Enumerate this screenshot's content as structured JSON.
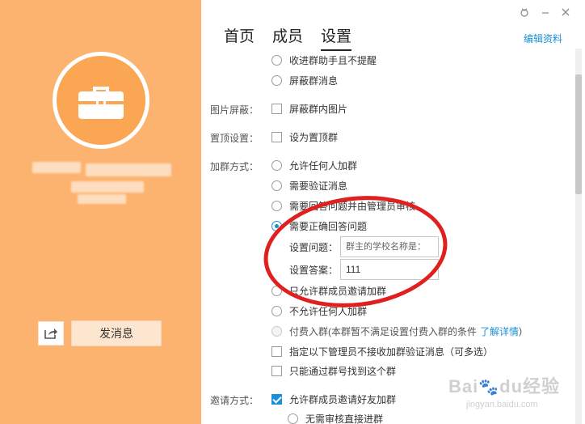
{
  "window": {
    "skin_icon": "skin-icon",
    "minimize_icon": "minimize-icon",
    "close_icon": "close-icon"
  },
  "profile": {
    "avatar_icon": "briefcase-icon",
    "share_icon": "share-icon",
    "send_message_label": "发消息"
  },
  "tabs": [
    {
      "label": "首页",
      "active": false
    },
    {
      "label": "成员",
      "active": false
    },
    {
      "label": "设置",
      "active": true
    }
  ],
  "edit_profile_label": "编辑资料",
  "settings": {
    "message_options": [
      {
        "label": "收进群助手且不提醒",
        "checked": false
      },
      {
        "label": "屏蔽群消息",
        "checked": false
      }
    ],
    "image_block": {
      "label": "图片屏蔽：",
      "option": {
        "label": "屏蔽群内图片",
        "checked": false
      }
    },
    "pin_top": {
      "label": "置顶设置：",
      "option": {
        "label": "设为置顶群",
        "checked": false
      }
    },
    "join_method": {
      "label": "加群方式：",
      "options": [
        {
          "label": "允许任何人加群",
          "checked": false
        },
        {
          "label": "需要验证消息",
          "checked": false
        },
        {
          "label": "需要回答问题并由管理员审核",
          "checked": false
        },
        {
          "label": "需要正确回答问题",
          "checked": true
        }
      ],
      "question": {
        "label": "设置问题：",
        "placeholder": "群主的学校名称是："
      },
      "answer": {
        "label": "设置答案：",
        "value": "111"
      },
      "more_options": [
        {
          "label": "只允许群成员邀请加群",
          "checked": false
        },
        {
          "label": "不允许任何人加群",
          "checked": false
        }
      ],
      "paid_join": {
        "label": "付费入群(本群暂不满足设置付费入群的条件",
        "link": "了解详情",
        "suffix": ")",
        "disabled": true
      },
      "admin_exclude": {
        "label": "指定以下管理员不接收加群验证消息（可多选）",
        "checked": false
      },
      "find_by_number": {
        "label": "只能通过群号找到这个群",
        "checked": false
      }
    },
    "invite_method": {
      "label": "邀请方式：",
      "option": {
        "label": "允许群成员邀请好友加群",
        "checked": true
      },
      "sub_option": {
        "label": "无需审核直接进群",
        "checked": false
      }
    }
  },
  "watermark": {
    "main": "Bai\u0000du经验",
    "sub": "jingyan.baidu.com"
  },
  "colors": {
    "sidebar": "#fcb36f",
    "accent": "#1a90d6",
    "annotation": "#e0201e"
  }
}
